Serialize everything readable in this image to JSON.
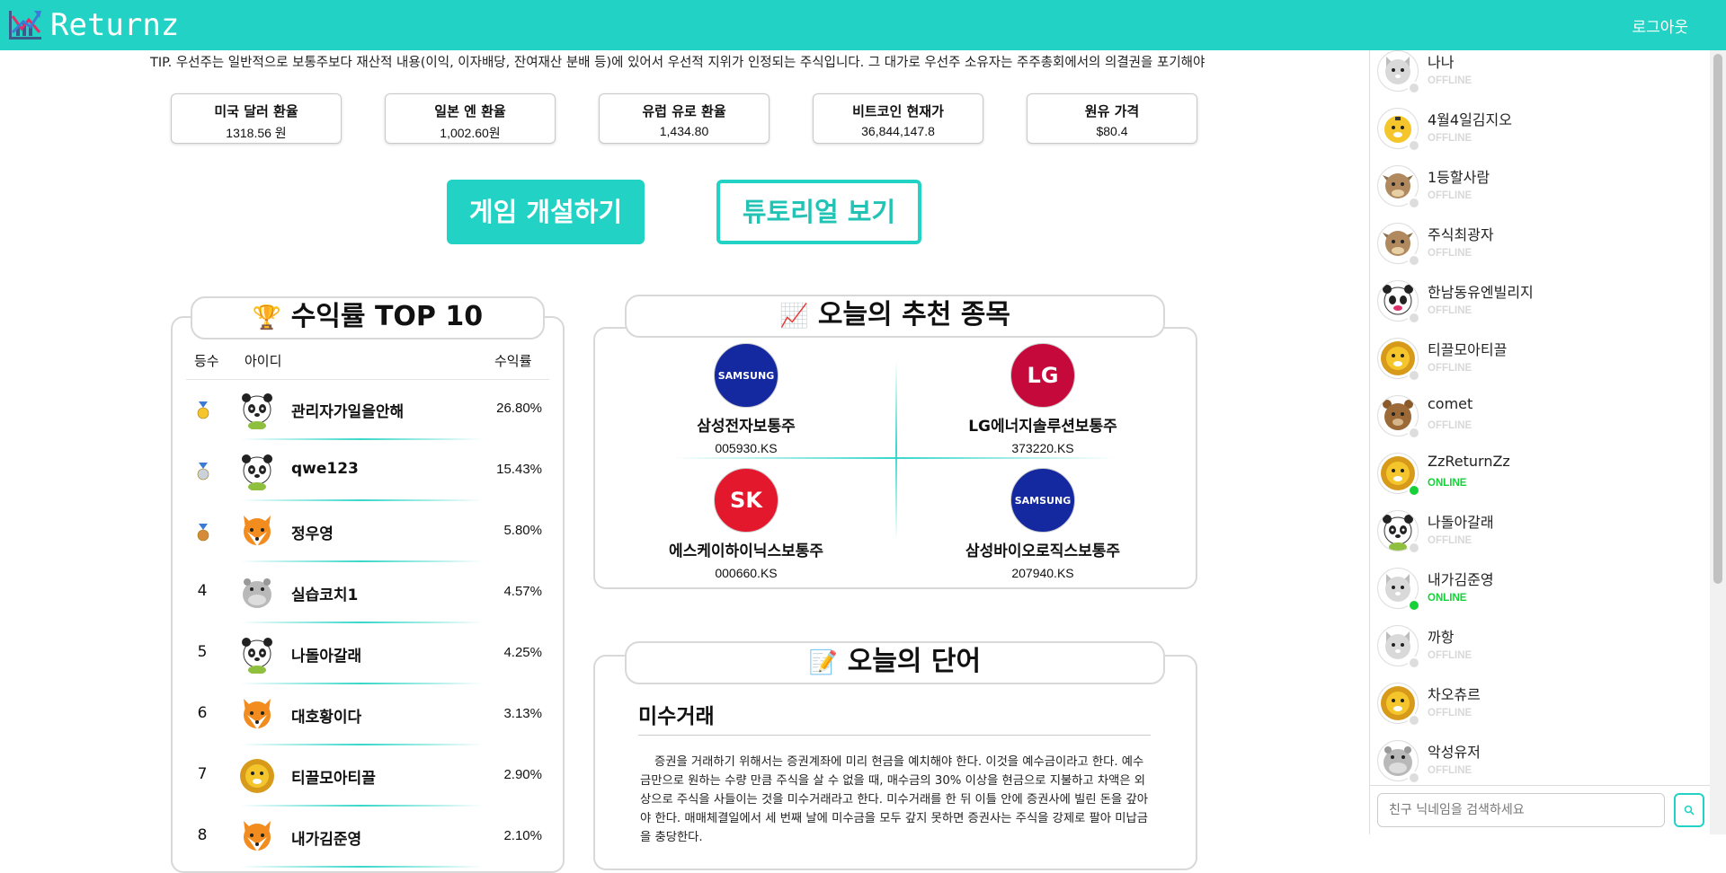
{
  "header": {
    "brand": "Returnz",
    "logout_label": "로그아웃"
  },
  "tip": "TIP. 우선주는 일반적으로 보통주보다 재산적 내용(이익, 이자배당, 잔여재산 분배 등)에 있어서 우선적 지위가 인정되는 주식입니다. 그 대가로 우선주 소유자는 주주총회에서의 의결권을 포기해야",
  "rates": [
    {
      "label": "미국 달러 환율",
      "value": "1318.56 원"
    },
    {
      "label": "일본 엔 환율",
      "value": "1,002.60원"
    },
    {
      "label": "유럽 유로 환율",
      "value": "1,434.80"
    },
    {
      "label": "비트코인 현재가",
      "value": "36,844,147.8"
    },
    {
      "label": "원유 가격",
      "value": "$80.4"
    }
  ],
  "buttons": {
    "create": "게임 개설하기",
    "tutorial": "튜토리얼 보기"
  },
  "ranking": {
    "title": "수익률 TOP 10",
    "col_rank": "등수",
    "col_id": "아이디",
    "col_rate": "수익률",
    "rows": [
      {
        "rank": "",
        "medal": "gold",
        "avatar": "panda",
        "name": "관리자가일을안해",
        "rate": "26.80%"
      },
      {
        "rank": "",
        "medal": "silver",
        "avatar": "panda",
        "name": "qwe123",
        "rate": "15.43%"
      },
      {
        "rank": "",
        "medal": "bronze",
        "avatar": "fox",
        "name": "정우영",
        "rate": "5.80%"
      },
      {
        "rank": "4",
        "medal": "",
        "avatar": "hippo",
        "name": "실습코치1",
        "rate": "4.57%"
      },
      {
        "rank": "5",
        "medal": "",
        "avatar": "panda",
        "name": "나돌아갈래",
        "rate": "4.25%"
      },
      {
        "rank": "6",
        "medal": "",
        "avatar": "fox",
        "name": "대호황이다",
        "rate": "3.13%"
      },
      {
        "rank": "7",
        "medal": "",
        "avatar": "lion",
        "name": "티끌모아티끌",
        "rate": "2.90%"
      },
      {
        "rank": "8",
        "medal": "",
        "avatar": "fox",
        "name": "내가김준영",
        "rate": "2.10%"
      }
    ]
  },
  "recommend": {
    "title": "오늘의 추천 종목",
    "stocks": [
      {
        "logo_text": "SAMSUNG",
        "logo_color": "#1428a0",
        "name": "삼성전자보통주",
        "code": "005930.KS"
      },
      {
        "logo_text": "LG",
        "logo_color": "#c6093b",
        "name": "LG에너지솔루션보통주",
        "code": "373220.KS"
      },
      {
        "logo_text": "SK",
        "logo_color": "#e3182d",
        "name": "에스케이하이닉스보통주",
        "code": "000660.KS"
      },
      {
        "logo_text": "SAMSUNG",
        "logo_color": "#1428a0",
        "name": "삼성바이오로직스보통주",
        "code": "207940.KS"
      }
    ]
  },
  "word": {
    "title": "오늘의 단어",
    "term": "미수거래",
    "desc": "증권을 거래하기 위해서는 증권계좌에 미리 현금을 예치해야 한다. 이것을 예수금이라고 한다. 예수금만으로 원하는 수량 만큼 주식을 살 수 없을 때, 매수금의 30% 이상을 현금으로 지불하고 차액은 외상으로 주식을 사들이는 것을 미수거래라고 한다. 미수거래를 한 뒤 이틀 안에 증권사에 빌린 돈을 갚아야 한다. 매매체결일에서 세 번째 날에 미수금을 모두 갚지 못하면 증권사는 주식을 강제로 팔아 미납금을 충당한다."
  },
  "friends": [
    {
      "name": "나나",
      "status": "OFFLINE",
      "online": false,
      "avatar": "cat"
    },
    {
      "name": "4월4일김지오",
      "status": "OFFLINE",
      "online": false,
      "avatar": "tiger"
    },
    {
      "name": "1등할사람",
      "status": "OFFLINE",
      "online": false,
      "avatar": "cow"
    },
    {
      "name": "주식최광자",
      "status": "OFFLINE",
      "online": false,
      "avatar": "cow"
    },
    {
      "name": "한남동유엔빌리지",
      "status": "OFFLINE",
      "online": false,
      "avatar": "panda2"
    },
    {
      "name": "티끌모아티끌",
      "status": "OFFLINE",
      "online": false,
      "avatar": "lion"
    },
    {
      "name": "comet",
      "status": "OFFLINE",
      "online": false,
      "avatar": "bear"
    },
    {
      "name": "ZzReturnZz",
      "status": "ONLINE",
      "online": true,
      "avatar": "lion"
    },
    {
      "name": "나돌아갈래",
      "status": "OFFLINE",
      "online": false,
      "avatar": "panda"
    },
    {
      "name": "내가김준영",
      "status": "ONLINE",
      "online": true,
      "avatar": "cat"
    },
    {
      "name": "까항",
      "status": "OFFLINE",
      "online": false,
      "avatar": "cat"
    },
    {
      "name": "차오츄르",
      "status": "OFFLINE",
      "online": false,
      "avatar": "lion"
    },
    {
      "name": "악성유저",
      "status": "OFFLINE",
      "online": false,
      "avatar": "hippo"
    }
  ],
  "search": {
    "placeholder": "친구 닉네임을 검색하세요"
  },
  "colors": {
    "accent": "#22d3c5",
    "online": "#18d13a",
    "offline": "#d8d8d8"
  }
}
